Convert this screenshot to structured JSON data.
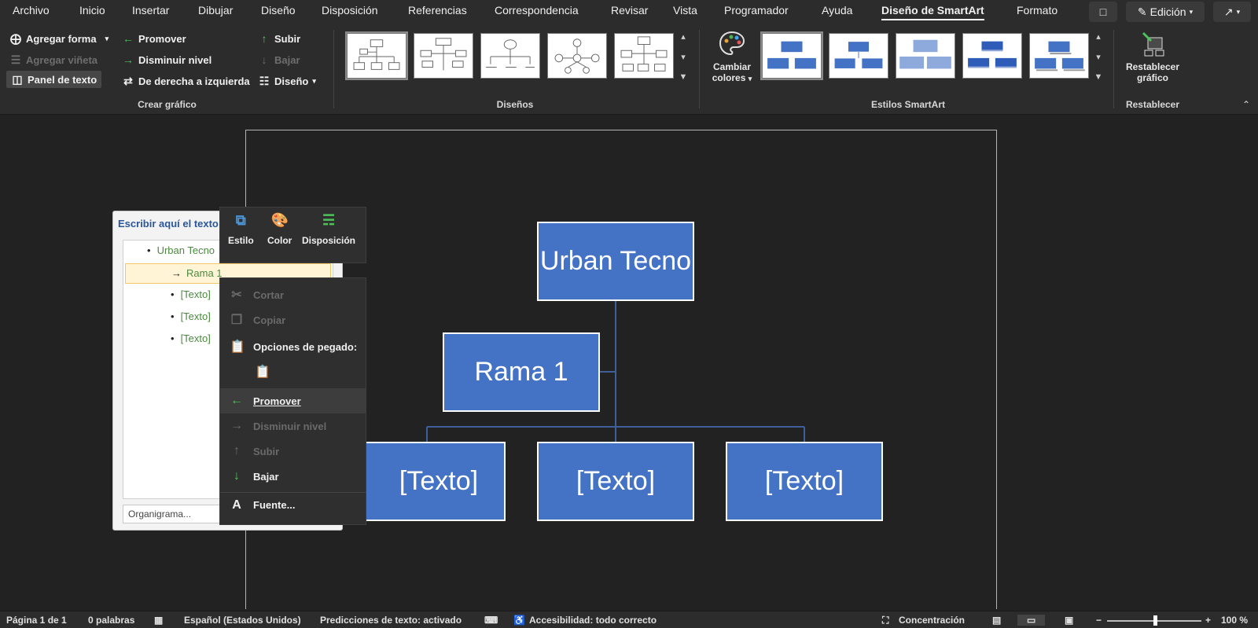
{
  "menu": {
    "tabs": [
      "Archivo",
      "Inicio",
      "Insertar",
      "Dibujar",
      "Diseño",
      "Disposición",
      "Referencias",
      "Correspondencia",
      "Revisar",
      "Vista",
      "Programador",
      "Ayuda",
      "Diseño de SmartArt",
      "Formato"
    ],
    "active_tab": "Diseño de SmartArt",
    "comment_icon": "comment-icon",
    "mode_label": "Edición",
    "share_icon": "share-icon"
  },
  "ribbon": {
    "crear": {
      "agregar_forma": "Agregar forma",
      "agregar_vineta": "Agregar viñeta",
      "panel_texto": "Panel de texto",
      "promover": "Promover",
      "disminuir": "Disminuir nivel",
      "derecha_izquierda": "De derecha a izquierda",
      "subir": "Subir",
      "bajar": "Bajar",
      "diseno": "Diseño",
      "label": "Crear gráfico"
    },
    "disenos_label": "Diseños",
    "cambiar_colores_1": "Cambiar",
    "cambiar_colores_2": "colores",
    "estilos_label": "Estilos SmartArt",
    "restablecer_1": "Restablecer",
    "restablecer_2": "gráfico",
    "restablecer_label": "Restablecer"
  },
  "smartart": {
    "root": "Urban Tecno",
    "assistant": "Rama 1",
    "children": [
      "[Texto]",
      "[Texto]",
      "[Texto]"
    ],
    "box_color": "#4472c4"
  },
  "text_pane": {
    "title": "Escribir aquí el texto",
    "items": [
      {
        "text": "Urban Tecno",
        "level": 1
      },
      {
        "text": "Rama 1",
        "level": 2
      },
      {
        "text": "[Texto]",
        "level": 2
      },
      {
        "text": "[Texto]",
        "level": 2
      },
      {
        "text": "[Texto]",
        "level": 2
      }
    ],
    "footer": "Organigrama..."
  },
  "mini_toolbar": {
    "estilo": "Estilo",
    "color": "Color",
    "disposicion": "Disposición"
  },
  "context_menu": {
    "cortar": "Cortar",
    "copiar": "Copiar",
    "opciones_pegado": "Opciones de pegado:",
    "promover": "Promover",
    "disminuir": "Disminuir nivel",
    "subir": "Subir",
    "bajar": "Bajar",
    "fuente": "Fuente..."
  },
  "status": {
    "pagina": "Página 1 de 1",
    "palabras": "0 palabras",
    "idioma": "Español (Estados Unidos)",
    "predicciones": "Predicciones de texto: activado",
    "accesibilidad": "Accesibilidad: todo correcto",
    "concentracion": "Concentración",
    "zoom": "100 %"
  }
}
